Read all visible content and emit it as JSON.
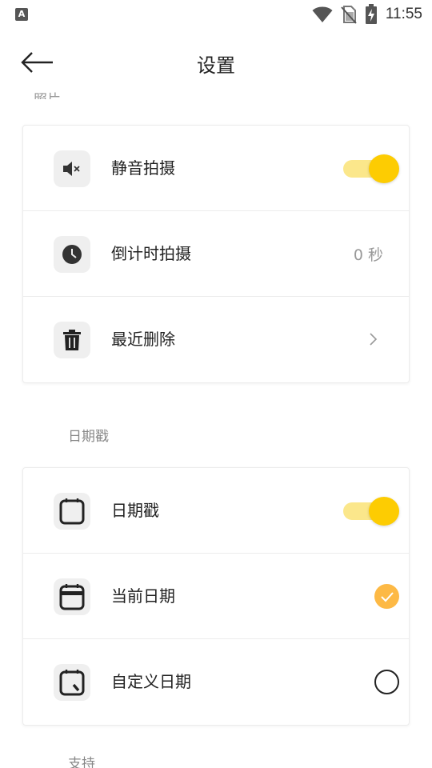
{
  "status_bar": {
    "notification_badge": "A",
    "time": "11:55",
    "icons": [
      "wifi-icon",
      "no-sim-icon",
      "battery-charging-icon"
    ]
  },
  "header": {
    "title": "设置",
    "back_icon": "arrow-left-icon"
  },
  "sections": {
    "top_partial_label": "照片",
    "date_stamp_label": "日期戳",
    "support_label": "支持"
  },
  "photo_settings": {
    "silent_shooting": {
      "label": "静音拍摄",
      "icon": "mute-speaker-icon",
      "enabled": true
    },
    "timer_shooting": {
      "label": "倒计时拍摄",
      "icon": "clock-icon",
      "value": "0 秒"
    },
    "recently_deleted": {
      "label": "最近删除",
      "icon": "trash-icon"
    }
  },
  "date_settings": {
    "date_stamp": {
      "label": "日期戳",
      "icon": "calendar-icon",
      "enabled": true
    },
    "current_date": {
      "label": "当前日期",
      "icon": "calendar-today-icon",
      "selected": true
    },
    "custom_date": {
      "label": "自定义日期",
      "icon": "calendar-edit-icon",
      "selected": false
    }
  },
  "colors": {
    "accent": "#fdcc02",
    "accent_track": "#fbe78b",
    "check": "#fdb945"
  }
}
